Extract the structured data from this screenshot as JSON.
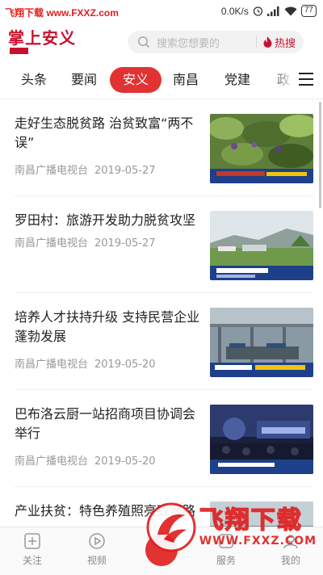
{
  "status_bar": {
    "watermark": "飞翔下载 www.FXXZ.com",
    "speed": "0.0K/s",
    "battery": "77"
  },
  "header": {
    "logo": "掌上安义",
    "search_placeholder": "搜索您想要的",
    "hot_label": "热搜"
  },
  "tabs": [
    "头条",
    "要闻",
    "安义",
    "南昌",
    "党建",
    "政"
  ],
  "active_tab": "安义",
  "news": [
    {
      "title": "走好生态脱贫路 治贫致富“两不误”",
      "source": "南昌广播电视台",
      "date": "2019-05-27"
    },
    {
      "title": "罗田村：旅游开发助力脱贫攻坚",
      "source": "南昌广播电视台",
      "date": "2019-05-27"
    },
    {
      "title": "培养人才扶持升级  支持民营企业蓬勃发展",
      "source": "南昌广播电视台",
      "date": "2019-05-20"
    },
    {
      "title": "巴布洛云厨一站招商项目协调会举行",
      "source": "南昌广播电视台",
      "date": "2019-05-20"
    },
    {
      "title": "产业扶贫：特色养殖照亮致富路",
      "source": "",
      "date": ""
    }
  ],
  "bottom_nav": [
    {
      "label": "关注",
      "icon": "plus-square-icon"
    },
    {
      "label": "视频",
      "icon": "play-circle-icon"
    },
    {
      "label": "",
      "icon": "center-home-icon"
    },
    {
      "label": "服务",
      "icon": "service-icon"
    },
    {
      "label": "我的",
      "icon": "user-icon"
    }
  ],
  "watermark": {
    "big": "飞翔下载",
    "small": "WWW.FXXZ.COM"
  },
  "colors": {
    "brand": "#c8102e",
    "active_tab": "#e23232",
    "meta_text": "#999999"
  }
}
